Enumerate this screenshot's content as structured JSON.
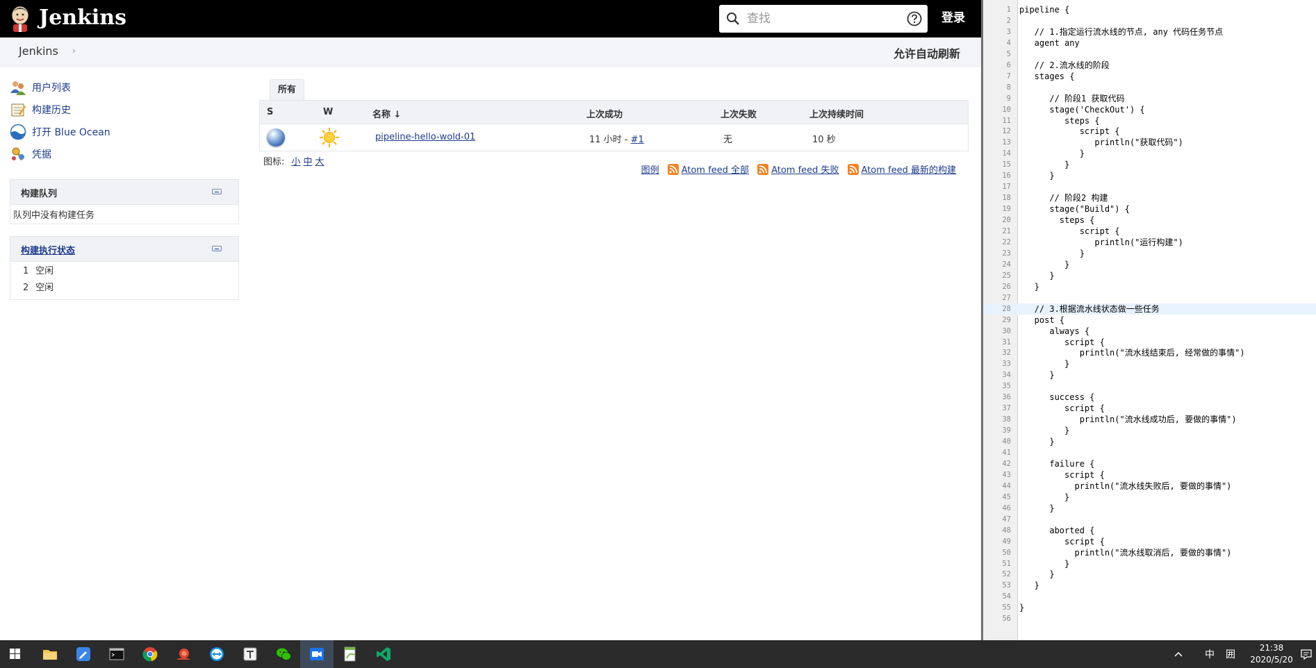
{
  "header": {
    "brand": "Jenkins",
    "search_placeholder": "查找",
    "login_label": "登录"
  },
  "breadcrumb": {
    "item": "Jenkins",
    "separator": "›",
    "auto_refresh": "允许自动刷新"
  },
  "sidebar": {
    "tasks": [
      {
        "label": "用户列表",
        "icon": "users-icon"
      },
      {
        "label": "构建历史",
        "icon": "notepad-icon"
      },
      {
        "label": "打开 Blue Ocean",
        "icon": "blue-ocean-icon"
      },
      {
        "label": "凭据",
        "icon": "credentials-icon"
      }
    ],
    "build_queue": {
      "title": "构建队列",
      "empty_text": "队列中没有构建任务"
    },
    "executors": {
      "title": "构建执行状态",
      "rows": [
        {
          "num": "1",
          "state": "空闲"
        },
        {
          "num": "2",
          "state": "空闲"
        }
      ]
    }
  },
  "main": {
    "tab": "所有",
    "columns": {
      "s": "S",
      "w": "W",
      "name": "名称 ↓",
      "last_success": "上次成功",
      "last_failure": "上次失败",
      "last_duration": "上次持续时间"
    },
    "rows": [
      {
        "name": "pipeline-hello-wold-01",
        "last_success_prefix": "11 小时 - ",
        "last_success_build": "#1",
        "last_failure": "无",
        "last_duration": "10 秒"
      }
    ],
    "icon_size": {
      "label": "图标: ",
      "small": "小",
      "medium": "中",
      "large": "大"
    },
    "feeds": {
      "legend": "图例",
      "all": "Atom feed 全部",
      "failures": "Atom feed 失败",
      "latest": "Atom feed 最新的构建"
    }
  },
  "editor": {
    "lines": [
      "pipeline {",
      "",
      "   // 1.指定运行流水线的节点, any 代码任务节点",
      "   agent any",
      "",
      "   // 2.流水线的阶段",
      "   stages {",
      "",
      "      // 阶段1 获取代码",
      "      stage('CheckOut') {",
      "         steps {",
      "            script {",
      "               println(\"获取代码\")",
      "            }",
      "         }",
      "      }",
      "",
      "      // 阶段2 构建",
      "      stage(\"Build\") {",
      "        steps {",
      "            script {",
      "               println(\"运行构建\")",
      "            }",
      "         }",
      "      }",
      "   }",
      "",
      "   // 3.根据流水线状态做一些任务",
      "   post {",
      "      always {",
      "         script {",
      "            println(\"流水线结束后, 经常做的事情\")",
      "         }",
      "      }",
      "",
      "      success {",
      "         script {",
      "            println(\"流水线成功后, 要做的事情\")",
      "         }",
      "      }",
      "",
      "      failure {",
      "         script {",
      "           println(\"流水线失败后, 要做的事情\")",
      "         }",
      "      }",
      "",
      "      aborted {",
      "         script {",
      "           println(\"流水线取消后, 要做的事情\")",
      "         }",
      "      }",
      "   }",
      "",
      "}",
      ""
    ],
    "highlighted_line": 28
  },
  "taskbar": {
    "apps": [
      "file-explorer-icon",
      "notes-icon",
      "terminal-icon",
      "chrome-icon",
      "snail-icon",
      "teamviewer-icon",
      "typora-icon",
      "wechat-icon",
      "video-meeting-icon",
      "notepad-plus-icon",
      "vscode-icon"
    ],
    "active_index": 8,
    "ime_lang": "中",
    "ime_mode": "囲",
    "time": "21:38",
    "date": "2020/5/20"
  },
  "colors": {
    "header_bg": "#000000",
    "link": "#1e3c8c",
    "panel_bg": "#f0f2f5",
    "taskbar_bg": "#2b2b2b"
  }
}
